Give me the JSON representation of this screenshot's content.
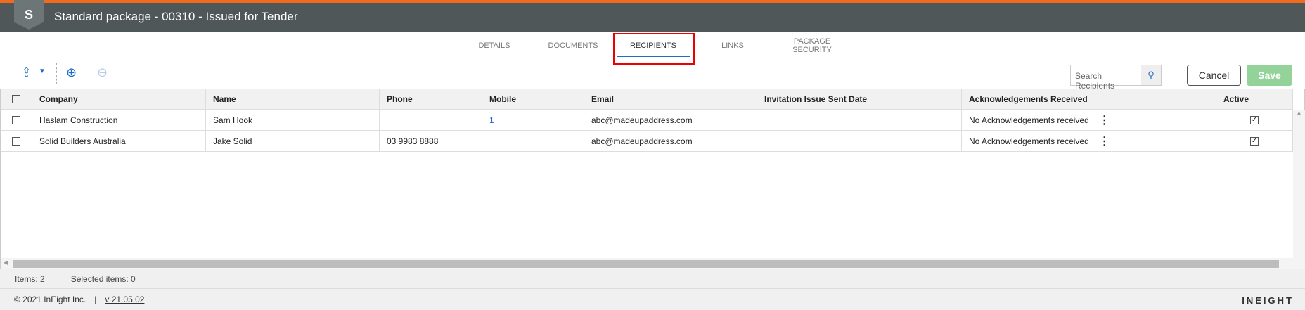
{
  "header": {
    "title": "Standard package - 00310 - Issued for Tender",
    "logo": "S"
  },
  "tabs": [
    {
      "label": "DETAILS"
    },
    {
      "label": "DOCUMENTS"
    },
    {
      "label": "RECIPIENTS"
    },
    {
      "label": "LINKS"
    },
    {
      "label": "PACKAGE SECURITY"
    }
  ],
  "toolbar": {
    "search_placeholder": "Search Recipients",
    "cancel": "Cancel",
    "save": "Save"
  },
  "table": {
    "columns": [
      "Company",
      "Name",
      "Phone",
      "Mobile",
      "Email",
      "Invitation Issue Sent Date",
      "Acknowledgements Received",
      "Active"
    ],
    "rows": [
      {
        "company": "Haslam Construction",
        "name": "Sam Hook",
        "phone": "",
        "mobile": "1",
        "email": "abc@madeupaddress.com",
        "sent": "",
        "ack": "No Acknowledgements received",
        "active": true
      },
      {
        "company": "Solid Builders Australia",
        "name": "Jake Solid",
        "phone": "03 9983 8888",
        "mobile": "",
        "email": "abc@madeupaddress.com",
        "sent": "",
        "ack": "No Acknowledgements received",
        "active": true
      }
    ]
  },
  "status": {
    "items": "Items: 2",
    "selected": "Selected items: 0"
  },
  "footer": {
    "copyright": "© 2021 InEight Inc.",
    "separator": "|",
    "version": "v 21.05.02",
    "brand": "INEIGHT"
  },
  "colors": {
    "accent": "#1e6ec8",
    "topbar": "#4f5758",
    "orange": "#f26b1d",
    "save": "#93d39a"
  }
}
